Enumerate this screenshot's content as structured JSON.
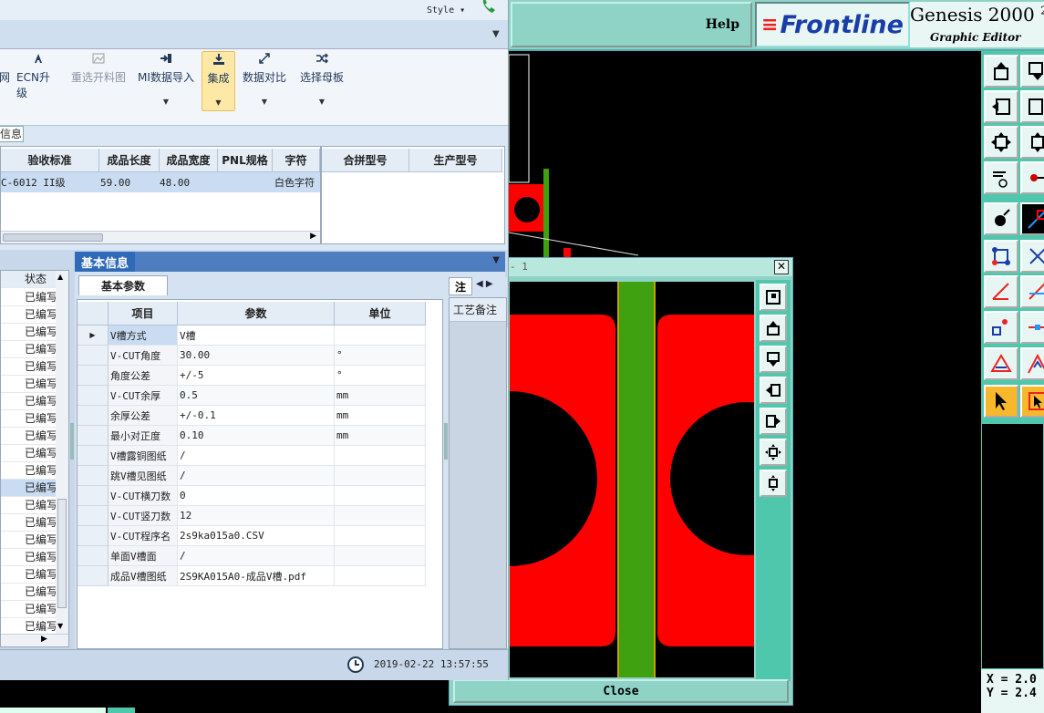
{
  "genesis": {
    "help_label": "Help",
    "logo_text": "Frontline",
    "product_name": "Genesis 2000",
    "product_suffix": "2",
    "product_subtitle": "Graphic Editor",
    "coord_x": "X = 2.0",
    "coord_y": "Y = 2.4",
    "zoom_window": {
      "title_fragment": "- 1",
      "close_label": "Close"
    },
    "colors": {
      "panel_teal": "#8fd3c7",
      "tool_teal": "#4fc7ad",
      "copper_red": "#ff0000",
      "trace_green": "#3fa010"
    }
  },
  "app": {
    "style_menu": "Style",
    "ribbon": {
      "buttons": [
        {
          "label": "网",
          "icon": "grid-icon"
        },
        {
          "label": "ECN升级",
          "icon": "ecn-icon"
        },
        {
          "label": "重选开料图",
          "icon": "image-icon"
        },
        {
          "label": "MI数据导入",
          "icon": "import-icon"
        },
        {
          "label": "集成",
          "icon": "integrate-icon"
        },
        {
          "label": "数据对比",
          "icon": "compare-icon"
        },
        {
          "label": "选择母板",
          "icon": "shuffle-icon"
        }
      ]
    },
    "info_tab": "信息",
    "top_grid": {
      "columns": [
        "验收标准",
        "成品长度",
        "成品宽度",
        "PNL规格",
        "字符"
      ],
      "row": [
        "C-6012 II级",
        "59.00",
        "48.00",
        "",
        "白色字符"
      ]
    },
    "right_grid": {
      "columns": [
        "合拼型号",
        "生产型号"
      ]
    },
    "left_panel": {
      "header": "状态",
      "items": [
        "已编写",
        "已编写",
        "已编写",
        "已编写",
        "已编写",
        "已编写",
        "已编写",
        "已编写",
        "已编写",
        "已编写",
        "已编写",
        "已编写",
        "已编写",
        "已编写",
        "已编写",
        "已编写",
        "已编写",
        "已编写",
        "已编写",
        "已编写"
      ]
    },
    "basic_info": {
      "title": "基本信息",
      "tab": "基本参数",
      "columns": [
        "项目",
        "参数",
        "单位"
      ],
      "rows": [
        {
          "item": "V槽方式",
          "param": "V槽",
          "unit": ""
        },
        {
          "item": "V-CUT角度",
          "param": "30.00",
          "unit": "°"
        },
        {
          "item": "角度公差",
          "param": "+/-5",
          "unit": "°"
        },
        {
          "item": "V-CUT余厚",
          "param": "0.5",
          "unit": "mm"
        },
        {
          "item": "余厚公差",
          "param": "+/-0.1",
          "unit": "mm"
        },
        {
          "item": "最小对正度",
          "param": "0.10",
          "unit": "mm"
        },
        {
          "item": "V槽露铜图纸",
          "param": "/",
          "unit": ""
        },
        {
          "item": "跳V槽见图纸",
          "param": "/",
          "unit": ""
        },
        {
          "item": "V-CUT横刀数",
          "param": "0",
          "unit": ""
        },
        {
          "item": "V-CUT竖刀数",
          "param": "12",
          "unit": ""
        },
        {
          "item": "V-CUT程序名",
          "param": "2s9ka015a0.CSV",
          "unit": ""
        },
        {
          "item": "单面V槽面",
          "param": "/",
          "unit": ""
        },
        {
          "item": "成品V槽图纸",
          "param": "2S9KA015A0-成品V槽.pdf",
          "unit": ""
        }
      ]
    },
    "craft": {
      "tab": "注",
      "column": "工艺备注"
    },
    "status_time": "2019-02-22 13:57:55"
  }
}
